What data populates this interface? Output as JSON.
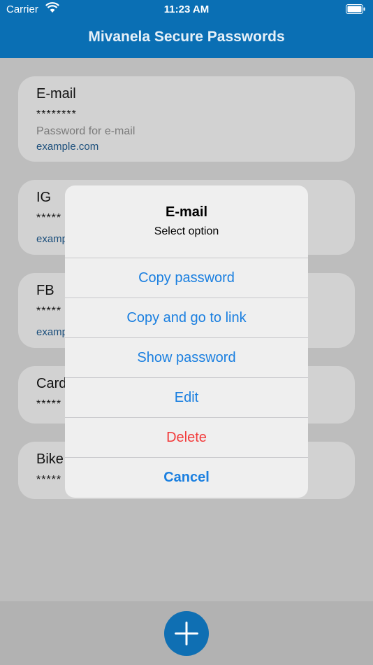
{
  "status_bar": {
    "carrier": "Carrier",
    "time": "11:23 AM",
    "wifi_icon": "wifi-icon",
    "battery_icon": "battery-icon"
  },
  "app": {
    "title": "Mivanela Secure Passwords"
  },
  "entries": [
    {
      "name": "E-mail",
      "password": "********",
      "description": "Password for e-mail",
      "link": "example.com"
    },
    {
      "name": "IG",
      "password": "*****",
      "link": "examp"
    },
    {
      "name": "FB",
      "password": "*****",
      "link": "examp"
    },
    {
      "name": "Card",
      "password": "*****"
    },
    {
      "name": "Bike",
      "password": "*****"
    }
  ],
  "dialog": {
    "title": "E-mail",
    "subtitle": "Select option",
    "options": {
      "copy_password": "Copy password",
      "copy_and_go": "Copy and go to link",
      "show_password": "Show password",
      "edit": "Edit",
      "delete": "Delete",
      "cancel": "Cancel"
    }
  },
  "fab": {
    "icon": "plus-icon"
  },
  "colors": {
    "brand": "#0a6fb4",
    "action": "#1a7fe0",
    "destructive": "#f23b3b"
  }
}
